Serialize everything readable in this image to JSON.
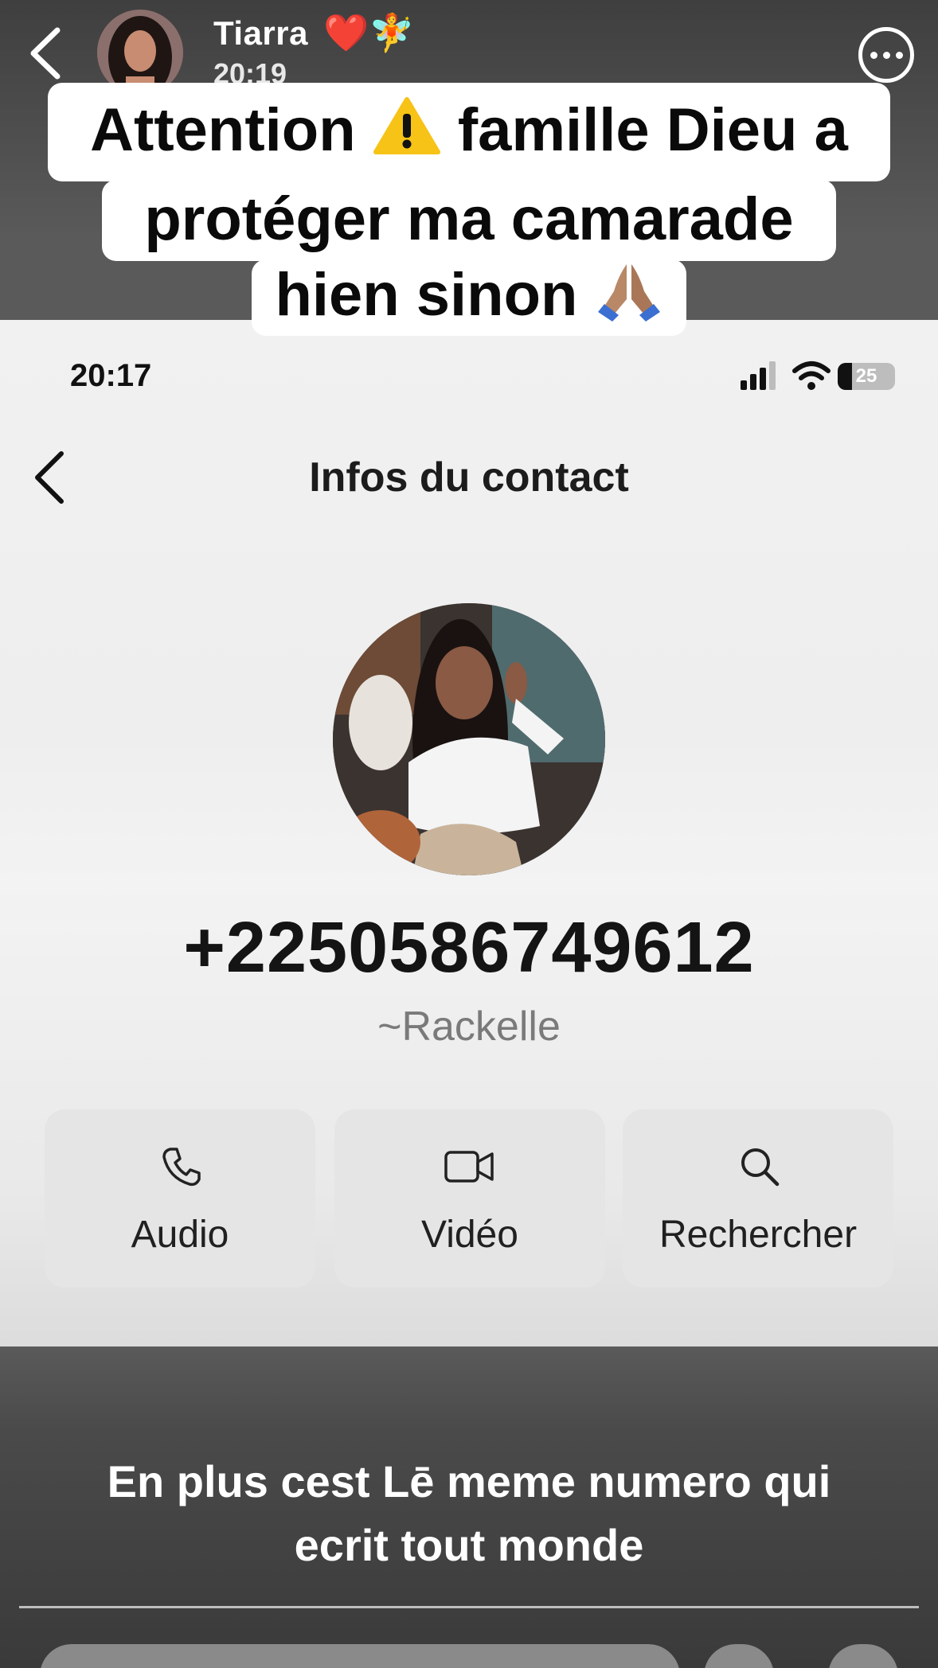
{
  "story": {
    "poster_name": "Tiarra",
    "poster_emoji": "❤️🧚",
    "time": "20:19"
  },
  "caption": {
    "line1_before": "Attention",
    "line1_emoji": "⚠️",
    "line1_after": "famille  Dieu a",
    "line2": "protéger ma camarade",
    "line3": "hien sinon",
    "line3_emoji": "🙏🏽"
  },
  "screenshot": {
    "status_time": "20:17",
    "battery": "25",
    "title": "Infos du contact",
    "phone_number": "+2250586749612",
    "contact_name": "~Rackelle",
    "actions": [
      {
        "label": "Audio",
        "icon": "phone-icon"
      },
      {
        "label": "Vidéo",
        "icon": "video-icon"
      },
      {
        "label": "Rechercher",
        "icon": "search-icon"
      }
    ]
  },
  "bottom_text": {
    "line1": "En plus cest Lē meme numero qui",
    "line2": "ecrit tout monde"
  },
  "colors": {
    "overlay_bg": "#5a5a5a",
    "caption_bg": "#ffffff",
    "card_bg": "#f1f1f1",
    "action_bg": "#e5e5e5"
  }
}
